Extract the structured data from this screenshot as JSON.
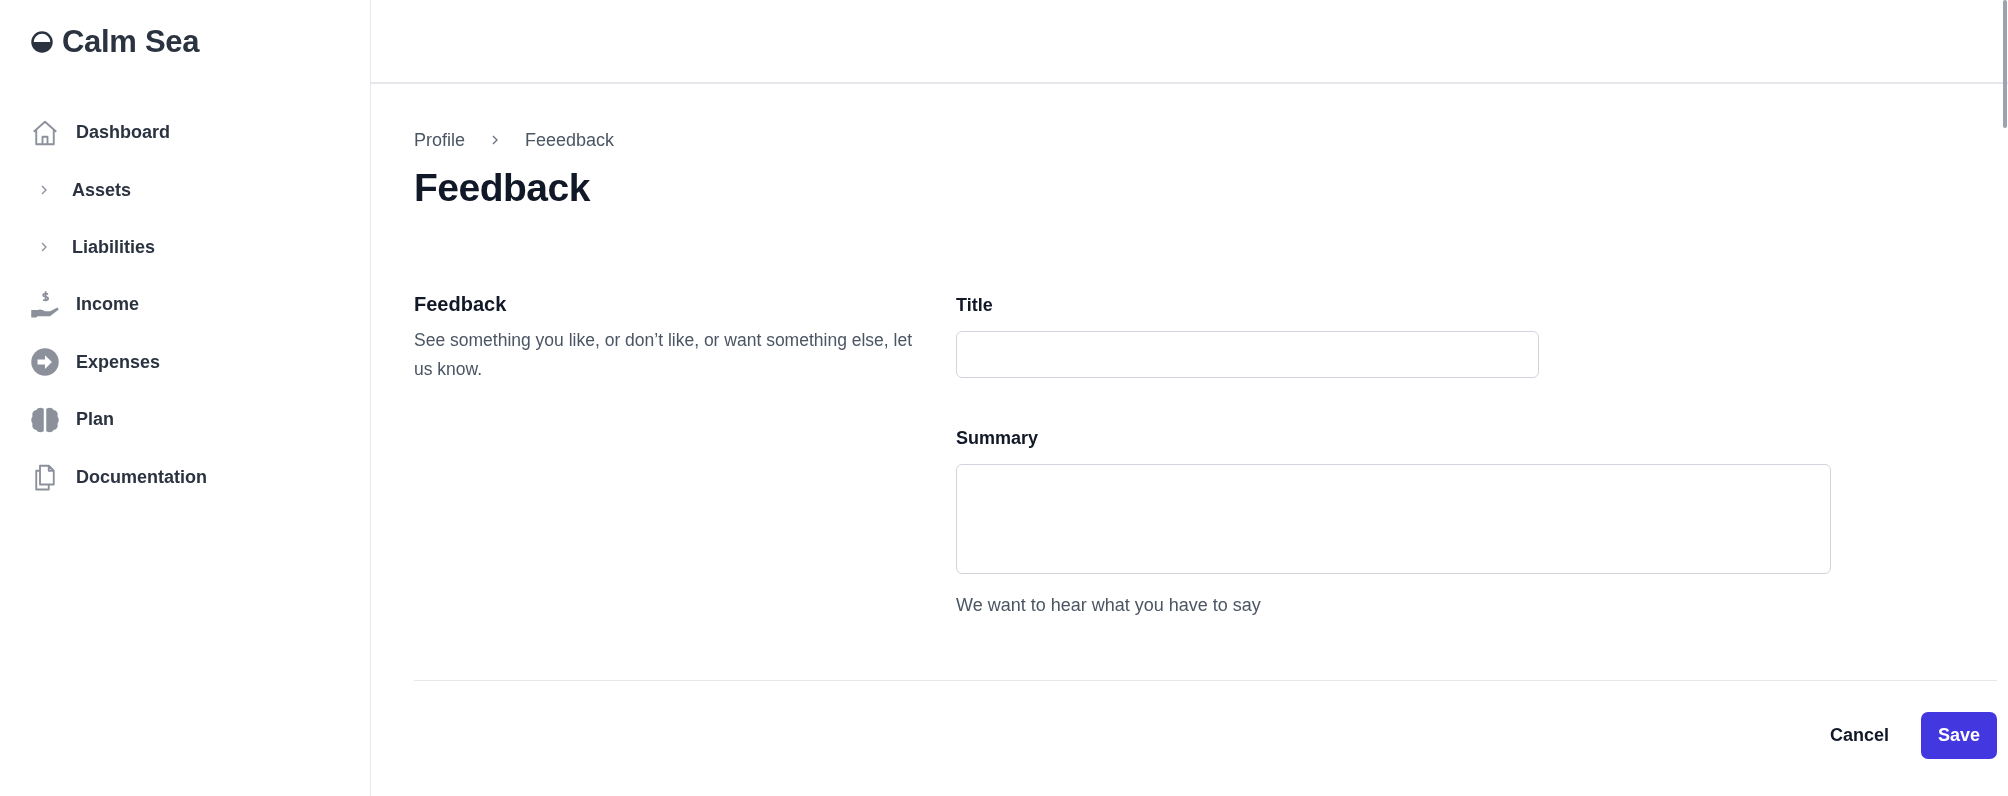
{
  "sidebar": {
    "brand": "Calm Sea",
    "items": [
      {
        "kind": "link",
        "label": "Dashboard"
      },
      {
        "kind": "group",
        "label": "Assets",
        "expanded": false
      },
      {
        "kind": "group",
        "label": "Liabilities",
        "expanded": false
      },
      {
        "kind": "link",
        "label": "Income"
      },
      {
        "kind": "link",
        "label": "Expenses"
      },
      {
        "kind": "link",
        "label": "Plan"
      },
      {
        "kind": "link",
        "label": "Documentation"
      }
    ]
  },
  "breadcrumb": [
    "Profile",
    "Feeedback"
  ],
  "page_title": "Feedback",
  "section": {
    "title": "Feedback",
    "description": "See something you like, or don’t like, or want something else, let us know."
  },
  "fields": [
    {
      "kind": "input",
      "label": "Title"
    },
    {
      "kind": "textarea",
      "label": "Summary",
      "hint": "We want to hear what you have to say"
    }
  ],
  "buttons": [
    {
      "kind": "secondary",
      "label": "Cancel"
    },
    {
      "kind": "primary",
      "label": "Save"
    }
  ]
}
